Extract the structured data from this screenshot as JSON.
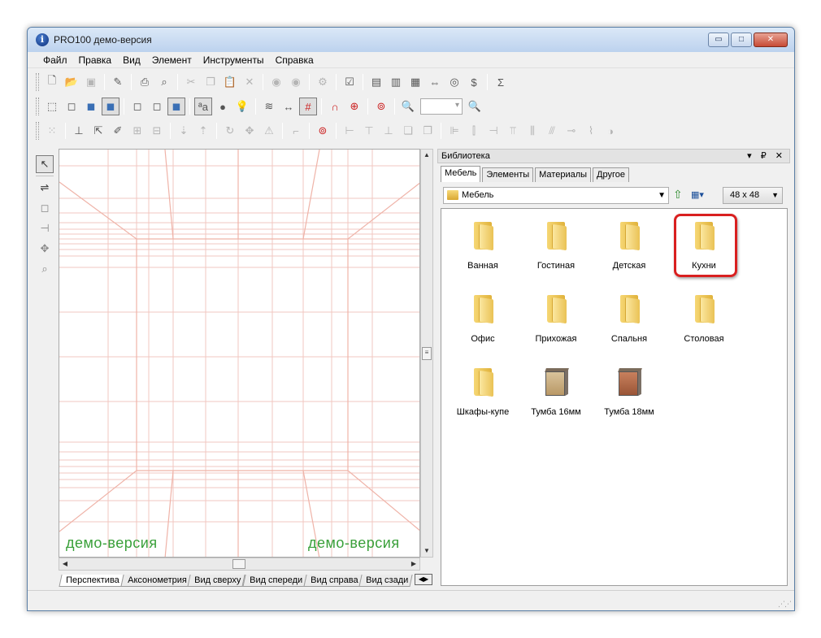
{
  "window": {
    "title": "PRO100 демо-версия",
    "controls": {
      "minimize": "▭",
      "maximize": "□",
      "close": "✕"
    }
  },
  "menu": [
    "Файл",
    "Правка",
    "Вид",
    "Элемент",
    "Инструменты",
    "Справка"
  ],
  "toolbar": {
    "sigma": "Σ",
    "labels_toggle": "ªa"
  },
  "viewport": {
    "watermark_left": "демо-версия",
    "watermark_right": "демо-версия"
  },
  "view_tabs": [
    "Перспектива",
    "Аксонометрия",
    "Вид сверху",
    "Вид спереди",
    "Вид справа",
    "Вид сзади"
  ],
  "library": {
    "title": "Библиотека",
    "header_controls": "▾ ₽ ✕",
    "tabs": [
      "Мебель",
      "Элементы",
      "Материалы",
      "Другое"
    ],
    "active_tab": "Мебель",
    "path": "Мебель",
    "icon_size": "48 x 48",
    "items": [
      {
        "label": "Ванная",
        "kind": "folder"
      },
      {
        "label": "Гостиная",
        "kind": "folder"
      },
      {
        "label": "Детская",
        "kind": "folder"
      },
      {
        "label": "Кухни",
        "kind": "folder",
        "highlighted": true
      },
      {
        "label": "Офис",
        "kind": "folder"
      },
      {
        "label": "Прихожая",
        "kind": "folder"
      },
      {
        "label": "Спальня",
        "kind": "folder"
      },
      {
        "label": "Столовая",
        "kind": "folder"
      },
      {
        "label": "Шкафы-купе",
        "kind": "folder"
      },
      {
        "label": "Тумба 16мм",
        "kind": "cabinet",
        "color": "#c7a877"
      },
      {
        "label": "Тумба 18мм",
        "kind": "cabinet",
        "color": "#b36b4a"
      }
    ]
  },
  "colors": {
    "grid_line": "#f2c7c0",
    "demo_text": "#3aa03a",
    "highlight": "#d92020"
  }
}
